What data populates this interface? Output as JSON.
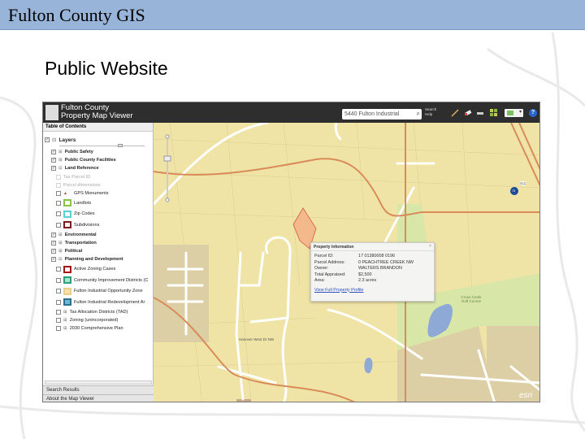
{
  "slide": {
    "title": "Fulton County GIS",
    "subtitle": "Public Website"
  },
  "app": {
    "name_line1": "Fulton County",
    "name_line2": "Property Map Viewer",
    "search": {
      "value": "5440 Fulton Industrial",
      "help_line1": "Search",
      "help_line2": "Help"
    },
    "tools": [
      "measure-icon",
      "eraser-icon",
      "legend-icon",
      "basemap-gallery-icon",
      "print-dropdown-icon",
      "help-icon"
    ]
  },
  "toc": {
    "header": "Table of Contents",
    "root": "Layers",
    "items": [
      {
        "label": "Public Safety",
        "checked": true,
        "bold": true,
        "expand": "+"
      },
      {
        "label": "Public County Facilities",
        "checked": true,
        "bold": true,
        "expand": "+"
      },
      {
        "label": "Land Reference",
        "checked": true,
        "bold": true,
        "expand": "-"
      },
      {
        "label": "Tax Parcel ID",
        "checked": false,
        "disabled": true
      },
      {
        "label": "Parcel dimensions",
        "checked": false,
        "disabled": true
      },
      {
        "label": "GPS Monuments",
        "checked": false,
        "symbol": "#c0392b"
      },
      {
        "label": "Landlots",
        "checked": false,
        "symbol": "#8bc34a"
      },
      {
        "label": "Zip Codes",
        "checked": false,
        "symbol": "#5bd0d0"
      },
      {
        "label": "Subdivisions",
        "checked": false,
        "symbol": "#7a1f1f"
      },
      {
        "label": "Environmental",
        "checked": true,
        "bold": true,
        "expand": "+"
      },
      {
        "label": "Transportation",
        "checked": true,
        "bold": true,
        "expand": "+"
      },
      {
        "label": "Political",
        "checked": true,
        "bold": true,
        "expand": "+"
      },
      {
        "label": "Planning and Development",
        "checked": true,
        "bold": true,
        "expand": "-"
      },
      {
        "label": "Active Zoning Cases",
        "checked": false,
        "symbol": "#a01818"
      },
      {
        "label": "Community Improvement Districts (C",
        "checked": false,
        "symbol": "#2e9e7a",
        "fill": "#a8e6d0"
      },
      {
        "label": "Fulton Industrial Opportunity Zone",
        "checked": false,
        "symbol": "#e8d08a",
        "fill": "#f3e2b0"
      },
      {
        "label": "Fulton Industrial Redevelopment Ar",
        "checked": false,
        "symbol": "#2d6f8f",
        "fill": "#6bb7d6"
      },
      {
        "label": "Tax Allocation Districts (TAD)",
        "checked": false,
        "expand": "+"
      },
      {
        "label": "Zoning (unincorporated)",
        "checked": false,
        "expand": "+"
      },
      {
        "label": "2030 Comprehensive Plan",
        "checked": false,
        "expand": "+"
      }
    ],
    "bottom_tabs": [
      "Search Results",
      "About the Map Viewer"
    ]
  },
  "popup": {
    "title": "Property Information",
    "fields": [
      {
        "k": "Parcel ID:",
        "v": "17 01380008 0196"
      },
      {
        "k": "Parcel Address:",
        "v": "0 PEACHTREE CREEK NW"
      },
      {
        "k": "Owner:",
        "v": "WALTERS BRANDON"
      },
      {
        "k": "Total Appraised:",
        "v": "$2,500"
      },
      {
        "k": "Area:",
        "v": "2.3 acres"
      }
    ],
    "link": "View Full Property Profile"
  },
  "map": {
    "labels": [
      "Cross Creek Golf Course",
      "Hanover West Dr NW",
      "411",
      "75"
    ],
    "colors": {
      "base": "#efe3a6",
      "park": "#d8e6a8",
      "water": "#8fa9d6",
      "parcel": "#f3b98a",
      "developed": "#dccfa6",
      "highway": "#d98c5a"
    },
    "attribution": "esri"
  }
}
